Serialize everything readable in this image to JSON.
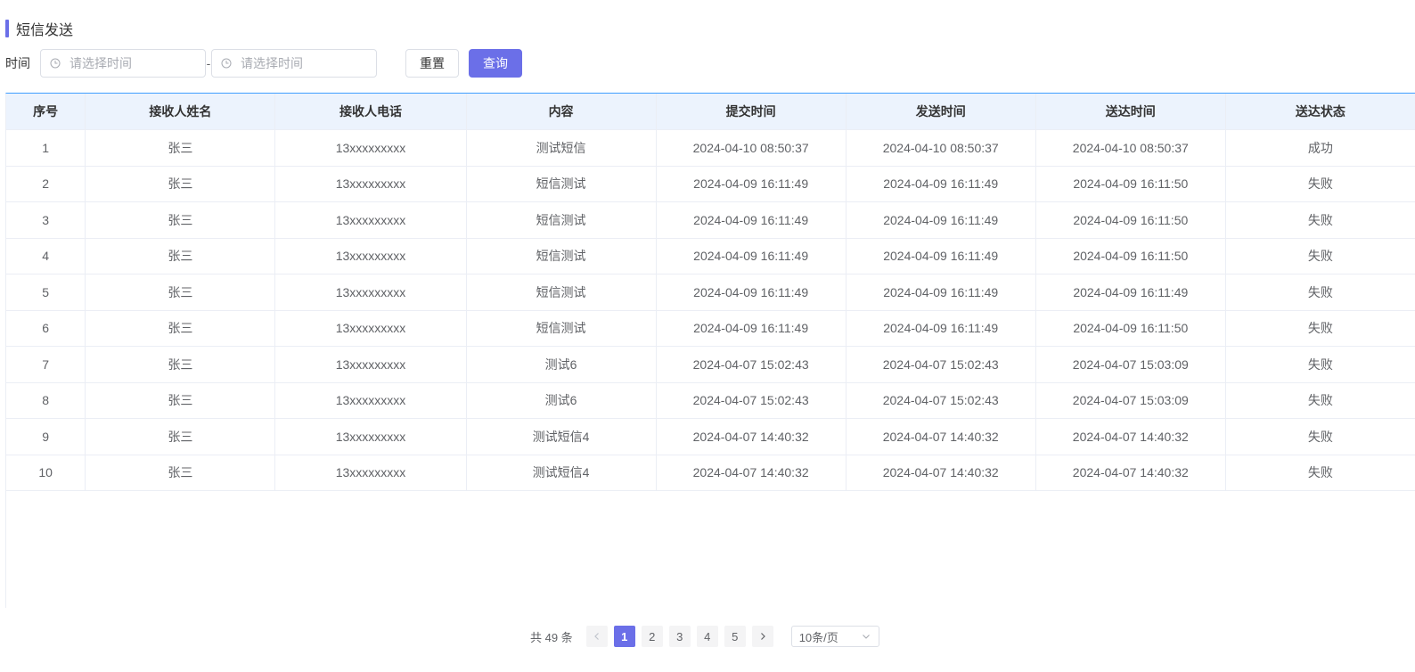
{
  "page": {
    "title": "短信发送"
  },
  "filter": {
    "label": "时间",
    "start_placeholder": "请选择时间",
    "end_placeholder": "请选择时间",
    "separator": "-",
    "reset_label": "重置",
    "query_label": "查询"
  },
  "table": {
    "columns": [
      "序号",
      "接收人姓名",
      "接收人电话",
      "内容",
      "提交时间",
      "发送时间",
      "送达时间",
      "送达状态"
    ],
    "rows": [
      [
        "1",
        "张三",
        "13xxxxxxxxx",
        "测试短信",
        "2024-04-10 08:50:37",
        "2024-04-10 08:50:37",
        "2024-04-10 08:50:37",
        "成功"
      ],
      [
        "2",
        "张三",
        "13xxxxxxxxx",
        "短信测试",
        "2024-04-09 16:11:49",
        "2024-04-09 16:11:49",
        "2024-04-09 16:11:50",
        "失败"
      ],
      [
        "3",
        "张三",
        "13xxxxxxxxx",
        "短信测试",
        "2024-04-09 16:11:49",
        "2024-04-09 16:11:49",
        "2024-04-09 16:11:50",
        "失败"
      ],
      [
        "4",
        "张三",
        "13xxxxxxxxx",
        "短信测试",
        "2024-04-09 16:11:49",
        "2024-04-09 16:11:49",
        "2024-04-09 16:11:50",
        "失败"
      ],
      [
        "5",
        "张三",
        "13xxxxxxxxx",
        "短信测试",
        "2024-04-09 16:11:49",
        "2024-04-09 16:11:49",
        "2024-04-09 16:11:49",
        "失败"
      ],
      [
        "6",
        "张三",
        "13xxxxxxxxx",
        "短信测试",
        "2024-04-09 16:11:49",
        "2024-04-09 16:11:49",
        "2024-04-09 16:11:50",
        "失败"
      ],
      [
        "7",
        "张三",
        "13xxxxxxxxx",
        "测试6",
        "2024-04-07 15:02:43",
        "2024-04-07 15:02:43",
        "2024-04-07 15:03:09",
        "失败"
      ],
      [
        "8",
        "张三",
        "13xxxxxxxxx",
        "测试6",
        "2024-04-07 15:02:43",
        "2024-04-07 15:02:43",
        "2024-04-07 15:03:09",
        "失败"
      ],
      [
        "9",
        "张三",
        "13xxxxxxxxx",
        "测试短信4",
        "2024-04-07 14:40:32",
        "2024-04-07 14:40:32",
        "2024-04-07 14:40:32",
        "失败"
      ],
      [
        "10",
        "张三",
        "13xxxxxxxxx",
        "测试短信4",
        "2024-04-07 14:40:32",
        "2024-04-07 14:40:32",
        "2024-04-07 14:40:32",
        "失败"
      ]
    ]
  },
  "pagination": {
    "total_text": "共 49 条",
    "pages": [
      "1",
      "2",
      "3",
      "4",
      "5"
    ],
    "current": "1",
    "prev_icon": "chevron-left-icon",
    "next_icon": "chevron-right-icon",
    "page_size": "10条/页"
  },
  "colors": {
    "accent": "#6b6fe8",
    "header_bg": "#ecf3fd",
    "table_top_border": "#409eff"
  }
}
